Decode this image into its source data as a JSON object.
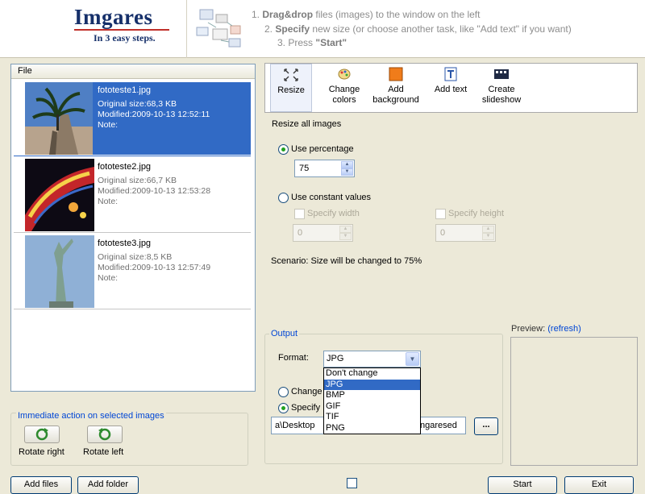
{
  "header": {
    "logo": "Imgares",
    "tagline": "In 3 easy steps.",
    "step1": {
      "num": "1.",
      "strong": "Drag&drop",
      "rest": "files (images)  to the window on the left"
    },
    "step2": {
      "num": "2.",
      "strong": "Specify",
      "rest": "new size (or choose another task, like \"Add text\" if you want)"
    },
    "step3": {
      "num": "3.",
      "text": "Press",
      "strong": "\"Start\""
    }
  },
  "file_list": {
    "column_header": "File",
    "files": [
      {
        "name": "fototeste1.jpg",
        "size": "Original size:68,3 KB",
        "modified": "Modified:2009-10-13 12:52:11",
        "note": "Note:"
      },
      {
        "name": "fototeste2.jpg",
        "size": "Original size:66,7 KB",
        "modified": "Modified:2009-10-13 12:53:28",
        "note": "Note:"
      },
      {
        "name": "fototeste3.jpg",
        "size": "Original size:8,5 KB",
        "modified": "Modified:2009-10-13 12:57:49",
        "note": "Note:"
      }
    ]
  },
  "immediate_actions": {
    "title": "Immediate action on selected images",
    "rotate_right": "Rotate right",
    "rotate_left": "Rotate left"
  },
  "bottom_buttons": {
    "add_files": "Add files",
    "add_folder": "Add folder",
    "start": "Start",
    "exit": "Exit"
  },
  "tools": [
    {
      "label": "Resize",
      "icon": "resize-arrows-icon"
    },
    {
      "label": "Change colors",
      "icon": "palette-icon"
    },
    {
      "label": "Add background",
      "icon": "orange-square-icon"
    },
    {
      "label": "Add text",
      "icon": "text-icon"
    },
    {
      "label": "Create slideshow",
      "icon": "film-strip-icon"
    }
  ],
  "resize": {
    "title": "Resize all images",
    "use_percentage": "Use percentage",
    "percentage_value": "75",
    "use_constant": "Use constant values",
    "specify_width": "Specify width",
    "specify_height": "Specify height",
    "width_value": "0",
    "height_value": "0",
    "scenario": "Scenario: Size will be changed to 75%"
  },
  "output": {
    "title": "Output",
    "format_label": "Format:",
    "format_value": "JPG",
    "format_options": [
      "Don't change",
      "JPG",
      "BMP",
      "GIF",
      "TIF",
      "PNG"
    ],
    "change_label": "Change",
    "specify_label": "Specify",
    "folder_left": "a\\Desktop",
    "folder_right": "ngaresed",
    "browse": "..."
  },
  "preview": {
    "label": "Preview:",
    "refresh": "(refresh)"
  },
  "colors": {
    "selection": "#316ac5",
    "accent_blue": "#0046d5",
    "logo_blue": "#16306a",
    "logo_red": "#c0302a"
  }
}
